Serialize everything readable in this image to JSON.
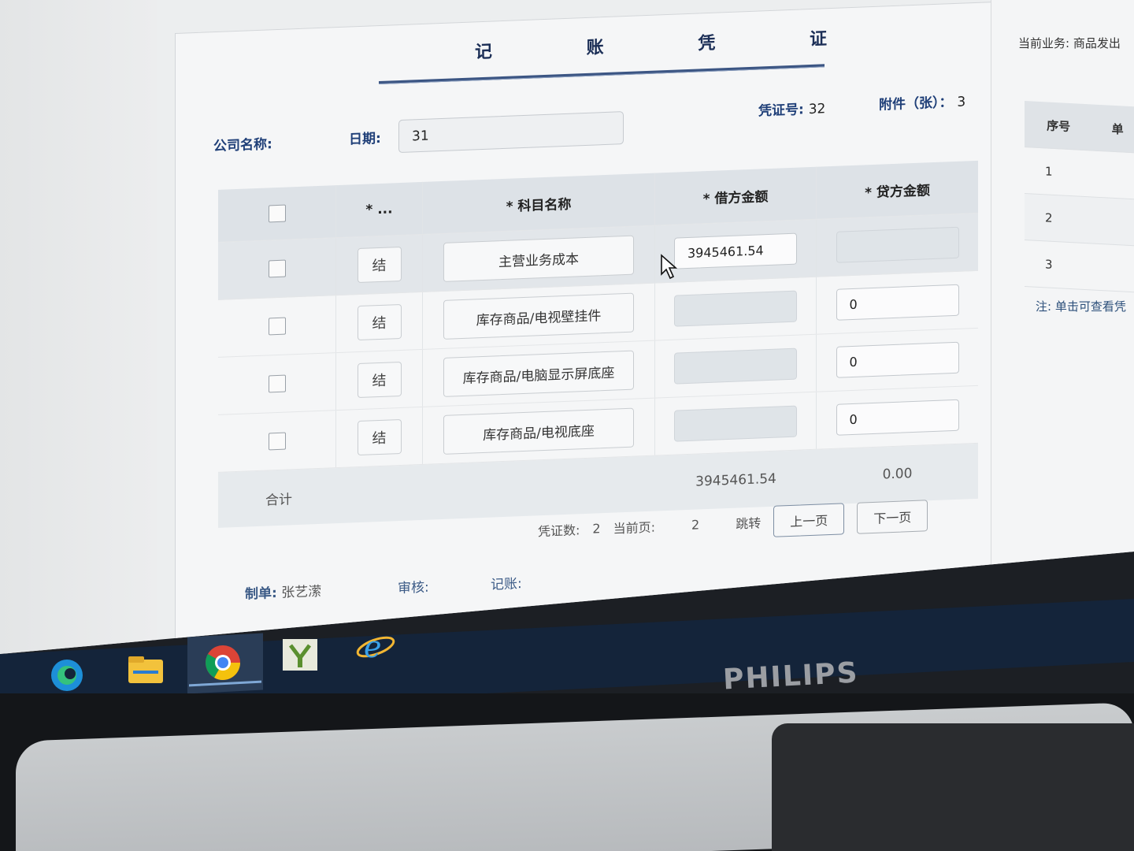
{
  "voucher": {
    "title": "记 账 凭 证",
    "company_label": "公司名称:",
    "date_label": "日期:",
    "date_value": "31",
    "voucher_no_label": "凭证号:",
    "voucher_no": "32",
    "attachments_label": "附件（张）：",
    "attachments": "3"
  },
  "table": {
    "headers": [
      "",
      "* ...",
      "* 科目名称",
      "* 借方金额",
      "* 贷方金额"
    ],
    "rows": [
      {
        "tag": "结",
        "account": "主营业务成本",
        "debit": "3945461.54",
        "credit": ""
      },
      {
        "tag": "结",
        "account": "库存商品/电视壁挂件",
        "debit": "",
        "credit": "0"
      },
      {
        "tag": "结",
        "account": "库存商品/电脑显示屏底座",
        "debit": "",
        "credit": "0"
      },
      {
        "tag": "结",
        "account": "库存商品/电视底座",
        "debit": "",
        "credit": "0"
      }
    ],
    "total_label": "合计",
    "total_debit": "3945461.54",
    "total_credit": "0.00"
  },
  "pager": {
    "count_label": "凭证数:",
    "count": "2",
    "current_label": "当前页:",
    "current": "2",
    "jump_label": "跳转",
    "prev_label": "上一页",
    "next_label": "下一页"
  },
  "footer": {
    "maker_label": "制单:",
    "maker": "张艺潆",
    "review_label": "审核:",
    "post_label": "记账:"
  },
  "side": {
    "current_business": "当前业务: 商品发出",
    "header_seq": "序号",
    "header_2": "单",
    "rows": [
      "1",
      "2",
      "3"
    ],
    "note": "注: 单击可查看凭"
  },
  "taskbar": {
    "icons": [
      "edge-icon",
      "file-explorer-icon",
      "chrome-icon",
      "app-icon",
      "ie-icon"
    ]
  },
  "monitor": {
    "brand": "PHILIPS"
  }
}
